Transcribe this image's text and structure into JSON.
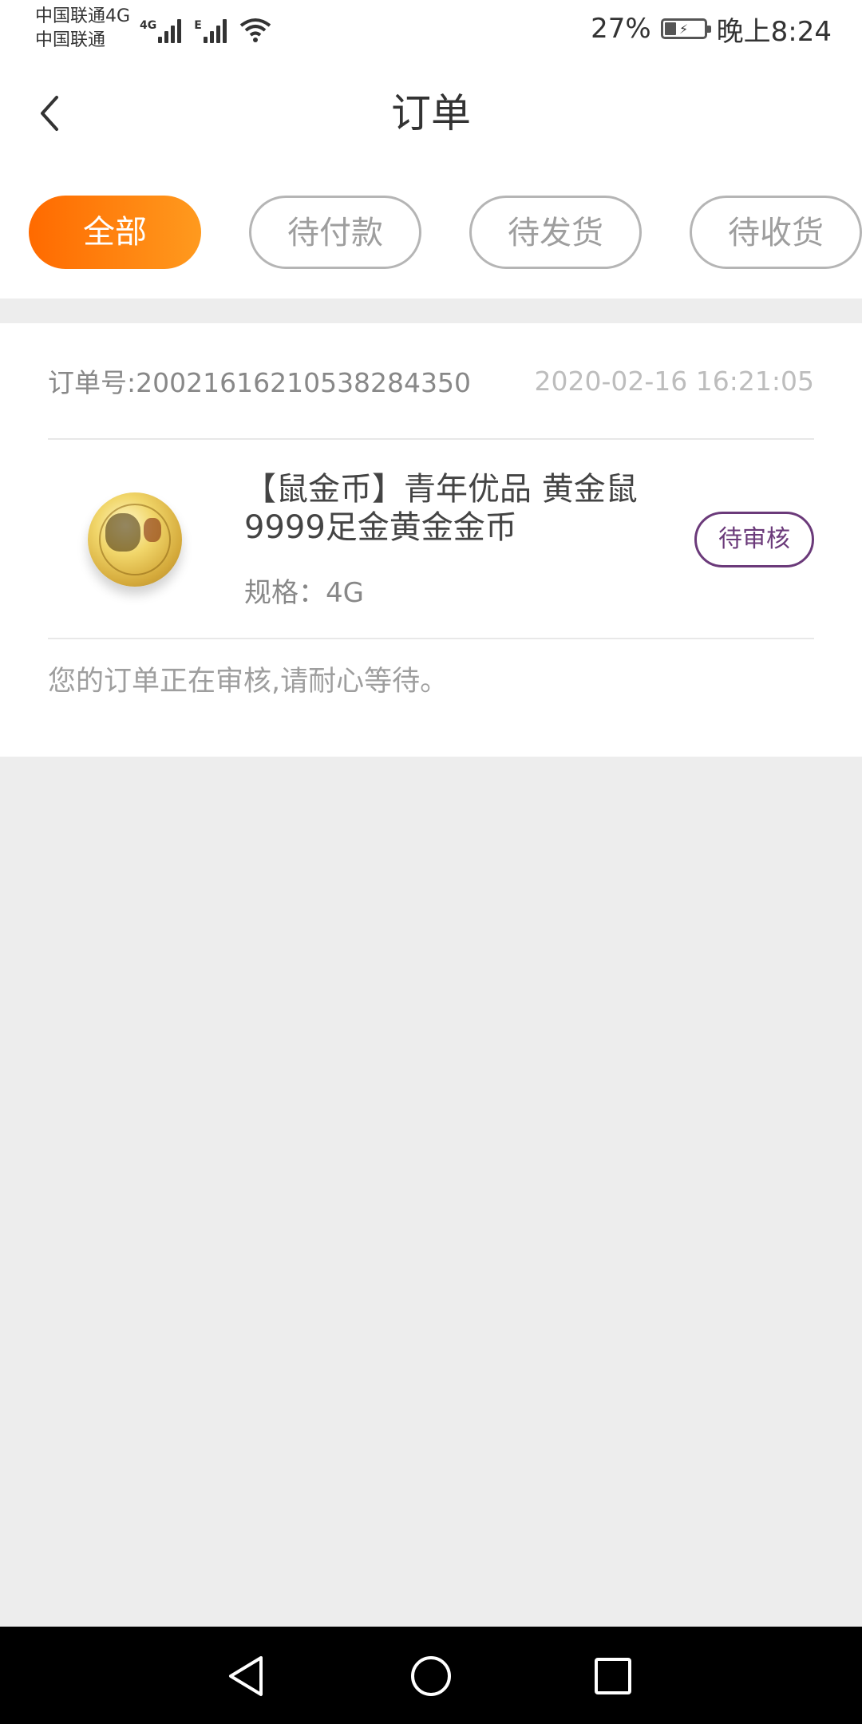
{
  "status_bar": {
    "carrier_line1": "中国联通4G",
    "carrier_line2": "中国联通",
    "net_type_1": "4G",
    "net_type_2": "E",
    "battery_percent": "27%",
    "battery_level": 0.27,
    "time": "晚上8:24"
  },
  "header": {
    "title": "订单",
    "back_icon": "chevron-left-icon"
  },
  "tabs": [
    {
      "label": "全部",
      "active": true
    },
    {
      "label": "待付款",
      "active": false
    },
    {
      "label": "待发货",
      "active": false
    },
    {
      "label": "待收货",
      "active": false
    }
  ],
  "order": {
    "order_no": "订单号:20021616210538284350",
    "time": "2020-02-16 16:21:05",
    "product_title": "【鼠金币】青年优品 黄金鼠9999足金黄金金币",
    "spec": "规格：4G",
    "status": "待审核",
    "note": "您的订单正在审核,请耐心等待。"
  },
  "colors": {
    "accent_start": "#ff6a00",
    "accent_end": "#ff9a1e",
    "status_purple": "#6b3a7a",
    "background": "#ededed"
  },
  "nav": {
    "back_icon": "triangle-back-icon",
    "home_icon": "circle-home-icon",
    "recents_icon": "square-recents-icon"
  }
}
